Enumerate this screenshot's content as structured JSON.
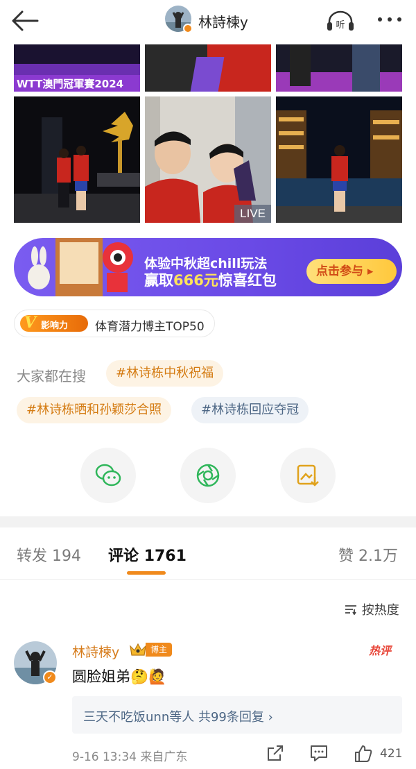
{
  "header": {
    "title": "林詩楝y"
  },
  "photos": {
    "banner_text_1": "WTT澳門冠軍賽2024",
    "live_label": "LIVE"
  },
  "banner": {
    "line1": "体验中秋超chill玩法",
    "line2_prefix": "赢取",
    "line2_highlight": "666元",
    "line2_suffix": "惊喜红包",
    "button": "点击参与 ▸"
  },
  "influence": {
    "tag": "影响力",
    "label": "体育潜力博主TOP50"
  },
  "hot_search": {
    "label": "大家都在搜",
    "chips": [
      "#林诗栋中秋祝福",
      "#林诗栋晒和孙颖莎合照",
      "#林诗栋回应夺冠"
    ]
  },
  "tabs": {
    "forward_label": "转发",
    "forward_count": "194",
    "comment_label": "评论",
    "comment_count": "1761",
    "like_label": "赞",
    "like_count": "2.1万"
  },
  "sort": {
    "label": "按热度"
  },
  "comment": {
    "author": "林詩楝y",
    "role_badge": "博主",
    "hot_tag": "热评",
    "text": "圆脸姐弟🤔🙋",
    "reply_summary": "三天不吃饭unn等人  共99条回复 ›",
    "time": "9-16 13:34",
    "location": "来自广东",
    "likes": "421"
  },
  "colors": {
    "accent": "#f08a1c",
    "link": "#4d6785",
    "banner": "#6a4ae6"
  }
}
